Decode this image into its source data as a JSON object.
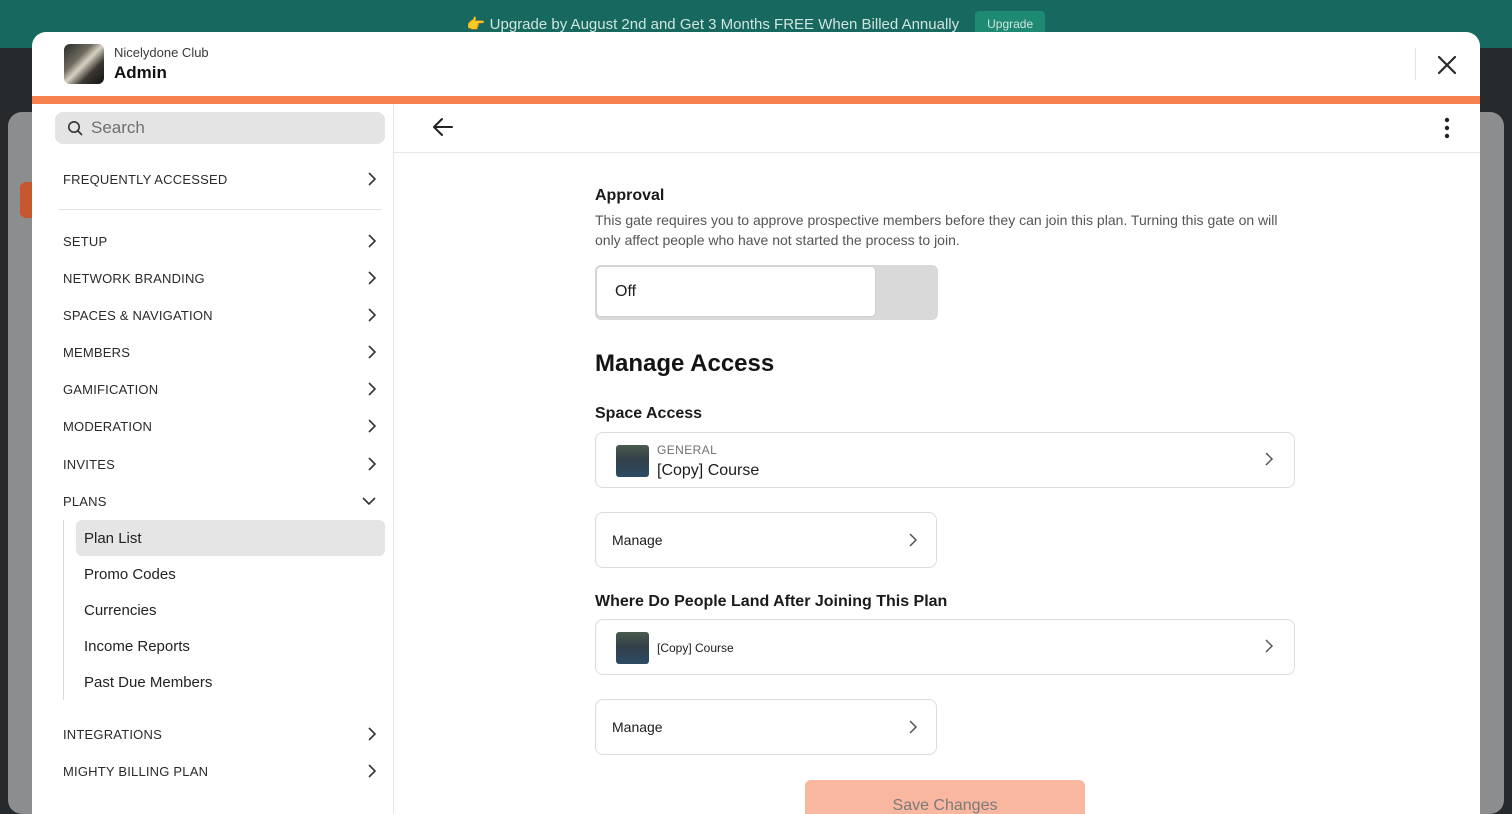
{
  "banner": {
    "text": "👉 Upgrade by August 2nd and Get 3 Months FREE When Billed Annually",
    "button": "Upgrade"
  },
  "header": {
    "club_name": "Nicelydone Club",
    "title": "Admin"
  },
  "search": {
    "placeholder": "Search"
  },
  "sidebar": {
    "frequently_accessed": "FREQUENTLY ACCESSED",
    "items": [
      "SETUP",
      "NETWORK BRANDING",
      "SPACES & NAVIGATION",
      "MEMBERS",
      "GAMIFICATION",
      "MODERATION",
      "INVITES",
      "PLANS"
    ],
    "plans_sub": [
      "Plan List",
      "Promo Codes",
      "Currencies",
      "Income Reports",
      "Past Due Members"
    ],
    "bottom_items": [
      "INTEGRATIONS",
      "MIGHTY BILLING PLAN"
    ]
  },
  "main": {
    "approval_title": "Approval",
    "approval_desc": "This gate requires you to approve prospective members before they can join this plan. Turning this gate on will only affect people who have not started the process to join.",
    "approval_toggle": "Off",
    "manage_access_title": "Manage Access",
    "space_access_title": "Space Access",
    "space_card": {
      "category": "GENERAL",
      "name": "[Copy] Course"
    },
    "manage_label": "Manage",
    "landing_title": "Where Do People Land After Joining This Plan",
    "landing_card": {
      "name": "[Copy] Course"
    },
    "save_label": "Save Changes"
  },
  "colors": {
    "accent": "#f5824f",
    "banner": "#17695f",
    "save_disabled": "#fab7a0"
  }
}
